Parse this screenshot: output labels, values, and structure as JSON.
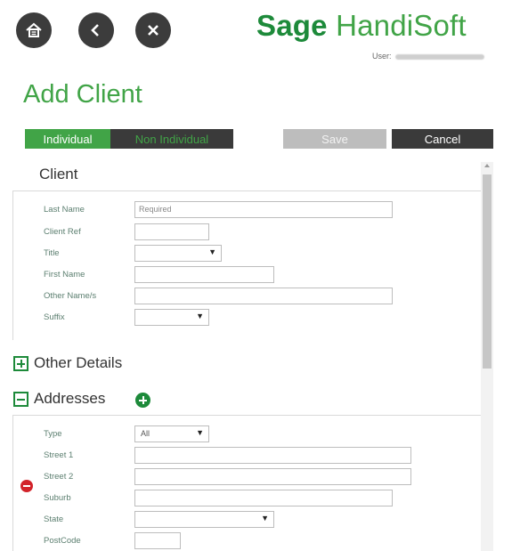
{
  "toolbar": {
    "home_icon": "home-icon",
    "back_icon": "chevron-left-icon",
    "close_icon": "close-icon"
  },
  "brand": {
    "part1": "Sage",
    "part2": "HandiSoft"
  },
  "user": {
    "label": "User:"
  },
  "page": {
    "title": "Add Client"
  },
  "actions": {
    "individual_label": "Individual",
    "non_individual_label": "Non Individual",
    "save_label": "Save",
    "cancel_label": "Cancel"
  },
  "client": {
    "section_title": "Client",
    "last_name_label": "Last Name",
    "last_name_placeholder": "Required",
    "client_ref_label": "Client Ref",
    "title_label": "Title",
    "first_name_label": "First Name",
    "other_names_label": "Other Name/s",
    "suffix_label": "Suffix"
  },
  "other_details": {
    "title": "Other Details"
  },
  "addresses": {
    "title": "Addresses",
    "type_label": "Type",
    "type_value": "All",
    "street1_label": "Street 1",
    "street2_label": "Street 2",
    "suburb_label": "Suburb",
    "state_label": "State",
    "postcode_label": "PostCode"
  },
  "colors": {
    "brand_green": "#41a447",
    "dark_green": "#1d8a3a",
    "dark_gray": "#3a3a3a",
    "disabled_gray": "#bdbdbd",
    "remove_red": "#d2232a"
  }
}
